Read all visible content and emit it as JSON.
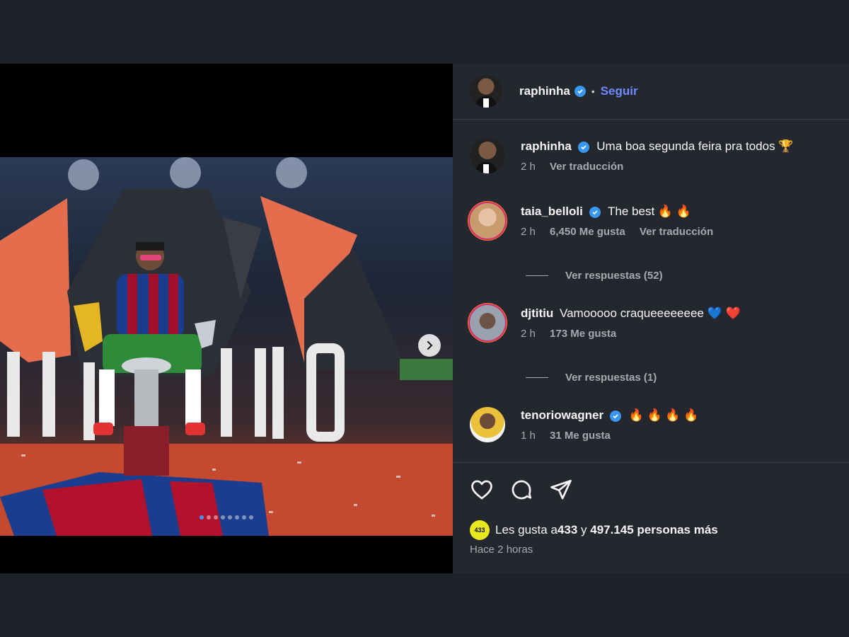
{
  "post": {
    "author": "raphinha",
    "follow_label": "Seguir",
    "separator": "•",
    "media": {
      "current_slide": 1,
      "total_slides": 8
    }
  },
  "comments": [
    {
      "user": "raphinha",
      "text": "Uma boa segunda feira pra todos 🏆",
      "time": "2 h",
      "likes": "",
      "translate": "Ver traducción"
    },
    {
      "user": "taia_belloli",
      "text": "The best 🔥 🔥",
      "time": "2 h",
      "likes": "6,450 Me gusta",
      "translate": "Ver traducción",
      "replies": "Ver respuestas (52)"
    },
    {
      "user": "djtitiu",
      "text": "Vamooooo craqueeeeeeee 💙 ❤️",
      "time": "2 h",
      "likes": "173 Me gusta",
      "replies": "Ver respuestas (1)"
    },
    {
      "user": "tenoriowagner",
      "text": "🔥 🔥 🔥 🔥",
      "time": "1 h",
      "likes": "31 Me gusta"
    }
  ],
  "footer": {
    "likes_prefix": "Les gusta a ",
    "likes_user": "433",
    "likes_middle": " y ",
    "likes_count": "497.145 personas más",
    "timestamp": "Hace 2 horas",
    "mini_avatar_text": "433"
  },
  "colors": {
    "accent": "#6f8bff",
    "verified": "#3897f0",
    "panel": "#25272e"
  },
  "icons": [
    "heart-icon",
    "comment-icon",
    "share-icon",
    "chevron-right-icon",
    "verified-icon"
  ]
}
